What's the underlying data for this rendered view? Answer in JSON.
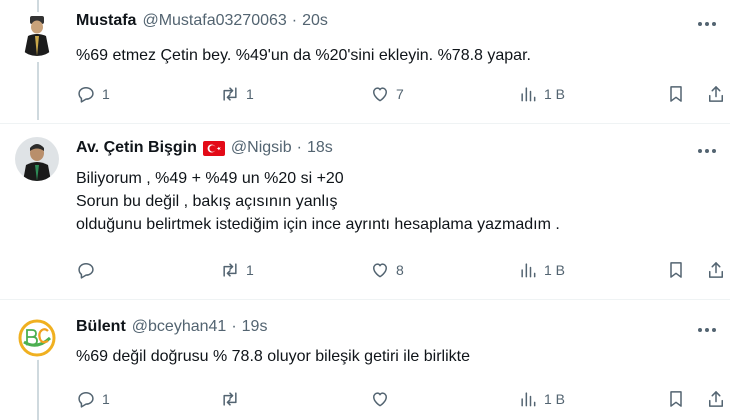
{
  "tweets": [
    {
      "name": "Mustafa",
      "handle": "@Mustafa03270063",
      "sep": "·",
      "time": "20s",
      "lines": [
        "%69 etmez Çetin bey. %49'un da %20'sini ekleyin. %78.8 yapar."
      ],
      "reply_count": "1",
      "retweet_count": "1",
      "like_count": "7",
      "view_count": "1 B"
    },
    {
      "name": "Av. Çetin Bişgin",
      "handle": "@Nigsib",
      "sep": "·",
      "time": "18s",
      "lines": [
        "Biliyorum , %49 + %49 un %20 si +20",
        "Sorun bu değil , bakış açısının yanlış",
        "olduğunu belirtmek istediğim için ince ayrıntı hesaplama yazmadım ."
      ],
      "reply_count": "",
      "retweet_count": "1",
      "like_count": "8",
      "view_count": "1 B"
    },
    {
      "name": "Bülent",
      "handle": "@bceyhan41",
      "sep": "·",
      "time": "19s",
      "lines": [
        "%69 değil doğrusu % 78.8 oluyor bileşik getiri ile birlikte"
      ],
      "reply_count": "1",
      "retweet_count": "",
      "like_count": "",
      "view_count": "1 B"
    }
  ],
  "icons": {
    "reply": "reply-icon",
    "retweet": "retweet-icon",
    "like": "heart-icon",
    "views": "views-icon",
    "bookmark": "bookmark-icon",
    "share": "share-icon",
    "more": "more-icon",
    "flag": "turkey-flag-icon"
  },
  "colors": {
    "text": "#0f1419",
    "secondary": "#536471",
    "divider": "#eff3f4",
    "flag_red": "#e30a17"
  }
}
